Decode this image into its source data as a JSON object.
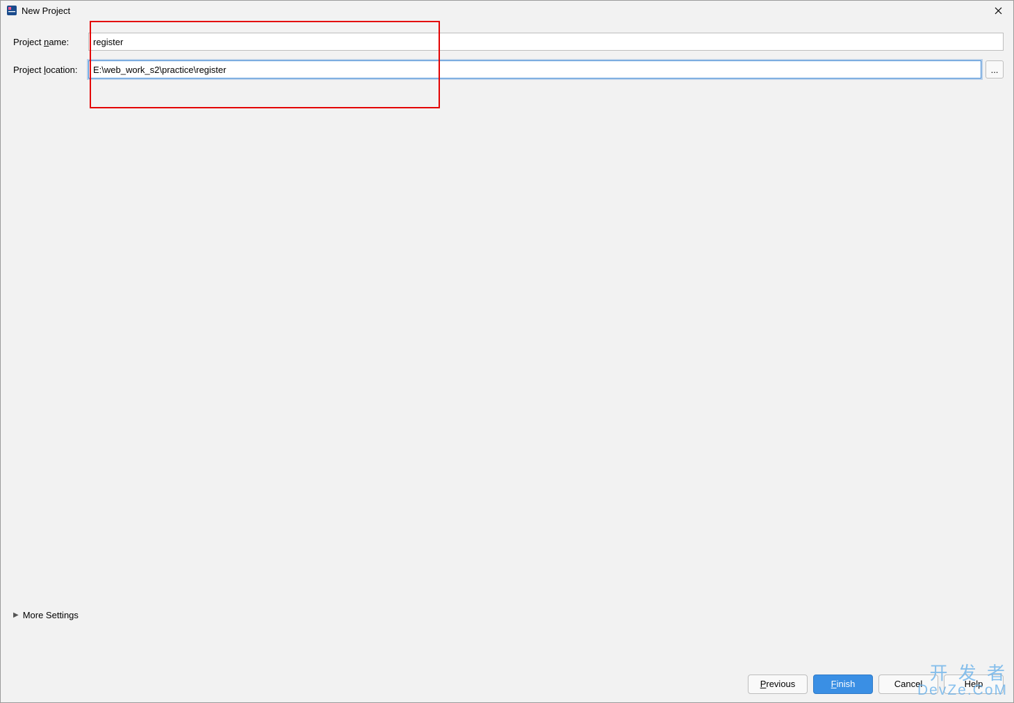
{
  "window": {
    "title": "New Project"
  },
  "form": {
    "name_label_pre": "Project ",
    "name_label_u": "n",
    "name_label_post": "ame:",
    "name_value": "register",
    "location_label_pre": "Project ",
    "location_label_u": "l",
    "location_label_post": "ocation:",
    "location_value": "E:\\web_work_s2\\practice\\register",
    "browse_label": "..."
  },
  "more_settings": {
    "label": "More Settings"
  },
  "footer": {
    "previous_u": "P",
    "previous_post": "revious",
    "finish_u": "F",
    "finish_post": "inish",
    "cancel": "Cancel",
    "help": "Help"
  },
  "watermark": {
    "line1": "开 发 者",
    "line2": "DevZe.CoM"
  }
}
